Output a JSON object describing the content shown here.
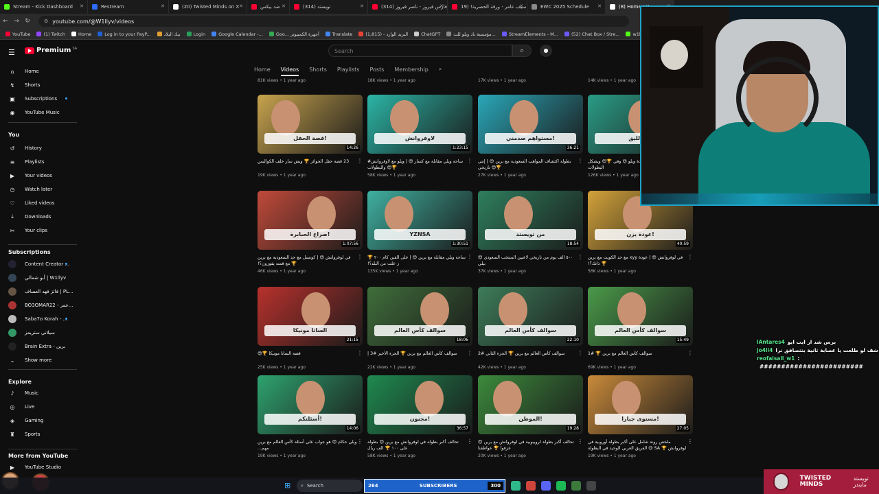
{
  "browser": {
    "tabs": [
      {
        "title": "Stream - Kick Dashboard",
        "color": "#53fc18"
      },
      {
        "title": "Restream",
        "color": "#2d6bfb"
      },
      {
        "title": "(20) Twisted Minds on X",
        "color": "#ffffff"
      },
      {
        "title": "ضد بيكس",
        "color": "#ff0033"
      },
      {
        "title": "(314) تويستد",
        "color": "#ff0033"
      },
      {
        "title": "(314) فارس فيروز - ناصر فيروز",
        "color": "#ff0033"
      },
      {
        "title": "سيف عامر - ورقة الحصرية! (19",
        "color": "#ff0033"
      },
      {
        "title": "EWC 2025 Schedule",
        "color": "#8a8a8a"
      },
      {
        "title": "(8) Home / X",
        "color": "#ffffff"
      }
    ],
    "url": "youtube.com/@W1llyv/videos",
    "bookmarks": [
      {
        "label": "YouTube",
        "color": "#ff0033"
      },
      {
        "label": "(1) Twitch",
        "color": "#9146ff"
      },
      {
        "label": "Home",
        "color": "#ffffff"
      },
      {
        "label": "Log in to your PayP...",
        "color": "#1f62d6"
      },
      {
        "label": "بنك البلاد",
        "color": "#e0a030"
      },
      {
        "label": "Login",
        "color": "#2b9f5a"
      },
      {
        "label": "Google Calendar -...",
        "color": "#4285f4"
      },
      {
        "label": "Goo... أجهزة الكمبيوتر",
        "color": "#34a853"
      },
      {
        "label": "Translate",
        "color": "#4285f4"
      },
      {
        "label": "البريد الوارد - (1,815)",
        "color": "#ea4335"
      },
      {
        "label": "ChatGPT",
        "color": "#cccccc"
      },
      {
        "label": "مؤسسة باد ويلو للت...",
        "color": "#888888"
      },
      {
        "label": "StreamElements - M...",
        "color": "#6b5bff"
      },
      {
        "label": "(52) Chat Box / Stre...",
        "color": "#6b5bff"
      },
      {
        "label": "w1llyv - Kick Stats...",
        "color": "#53fc18"
      }
    ]
  },
  "header": {
    "logo": "Premium",
    "country": "SA",
    "search_placeholder": "Search"
  },
  "sidebar": {
    "main": [
      {
        "label": "Home",
        "icon": "⌂"
      },
      {
        "label": "Shorts",
        "icon": "↯"
      },
      {
        "label": "Subscriptions",
        "icon": "▣"
      },
      {
        "label": "YouTube Music",
        "icon": "◉"
      }
    ],
    "you_title": "You",
    "you": [
      {
        "label": "History",
        "icon": "↺"
      },
      {
        "label": "Playlists",
        "icon": "≡"
      },
      {
        "label": "Your videos",
        "icon": "▶"
      },
      {
        "label": "Watch later",
        "icon": "◷"
      },
      {
        "label": "Liked videos",
        "icon": "♡"
      },
      {
        "label": "Downloads",
        "icon": "⤓"
      },
      {
        "label": "Your clips",
        "icon": "✂"
      }
    ],
    "subs_title": "Subscriptions",
    "subscriptions": [
      {
        "label": "Content Creator ...",
        "color": "#222233"
      },
      {
        "label": "أبو شمالي | W1llyv",
        "color": "#334455"
      },
      {
        "label": "فائز فهد العساف | PL...",
        "color": "#665544"
      },
      {
        "label": "BO3OMAR22 - عمر...",
        "color": "#aa3333"
      },
      {
        "label": "Saba7o Korah - ...",
        "color": "#bbbbbb"
      },
      {
        "label": "سيلاني ستريمز",
        "color": "#339966"
      },
      {
        "label": "Brain Extra - برين",
        "color": "#222222"
      }
    ],
    "show_more": "Show more",
    "explore_title": "Explore",
    "explore": [
      {
        "label": "Music",
        "icon": "♪"
      },
      {
        "label": "Live",
        "icon": "◎"
      },
      {
        "label": "Gaming",
        "icon": "◈"
      },
      {
        "label": "Sports",
        "icon": "♜"
      }
    ],
    "more_title": "More from YouTube",
    "more": [
      {
        "label": "YouTube Studio",
        "icon": "▶"
      }
    ]
  },
  "channel_tabs": [
    "Home",
    "Videos",
    "Shorts",
    "Playlists",
    "Posts",
    "Membership"
  ],
  "active_tab": "Videos",
  "top_meta": [
    "81K views • 1 year ago",
    "18K views • 1 year ago",
    "17K views • 1 year ago",
    "14K views • 1 year ago"
  ],
  "videos": [
    {
      "title": "23 قصة حفل الجوائز 🏆 ويش سار خلف الكواليس",
      "meta": "19K views • 1 year ago",
      "duration": "14:26",
      "caption": "قصة الحفل!",
      "bg": "#c7a34d"
    },
    {
      "title": "ساحة ويلي مقابلة مع كسار 😍 | ويلو مع لاوفروانش# 🏆😍 والبطولات",
      "meta": "58K views • 1 year ago",
      "duration": "1:23:15",
      "caption": "لاوفروانش",
      "bg": "#2bb5a6"
    },
    {
      "title": "بطولة اكتشاف المواهب السعودية مع برين 😍 | إنتي 🏆😍 تاريخي",
      "meta": "27K views • 1 year ago",
      "duration": "36:21",
      "caption": "مستواهم صدمني!",
      "bg": "#2aa7b8"
    },
    {
      "title": "كشف كل الحقائق 😍 | عادة ويلو 😍 وفي 🏆😍 ويشكل البطولات",
      "meta": "126K views • 1 year ago",
      "duration": "",
      "caption": "من الليق",
      "bg": "#2a9c86"
    },
    {
      "title": "في لوفروانش 😍 | كونسل مع حد السعودية مع برين 🏆 مع قمته يفوزون؟!",
      "meta": "46K views • 1 year ago",
      "duration": "1:07:56",
      "caption": "صراع الجبابرة!",
      "bg": "#c04a3a"
    },
    {
      "title": "ساحة ويلي مقابلة مع برين 😍 | على الفين كام ٢٠٠ 🏆 ز علت من البلد؟!",
      "meta": "135K views • 1 year ago",
      "duration": "1:30:51",
      "caption": "YZNSA",
      "bg": "#3fb0a0"
    },
    {
      "title": "٥٠٠ الف يوم من تاريخي لاعبين المنتخب السعودي 😍 بيلي",
      "meta": "37K views • 1 year ago",
      "duration": "18:54",
      "caption": "من تويستد",
      "bg": "#2e7f5e"
    },
    {
      "title": "في لوفروانش 😍 | عودة xyy مع حد الكويت مع برين 🏆 ذاتك؟!",
      "meta": "56K views • 1 year ago",
      "duration": "40:59",
      "caption": "عودة يزن!",
      "bg": "#d3a23a"
    },
    {
      "title": "قصة الساتا مونيكا 🏆😍",
      "meta": "25K views • 1 year ago",
      "duration": "21:15",
      "caption": "الساتا مونيكا",
      "bg": "#b8312c"
    },
    {
      "title": "سوالف كأس العالم مع برين 🏆 الجزء الأخير #3 |",
      "meta": "22K views • 1 year ago",
      "duration": "18:06",
      "caption": "سوالف كأس العالم",
      "bg": "#3f6e3a"
    },
    {
      "title": "سوالف كأس العالم مع برين 🏆 الجزء الثاني #2",
      "meta": "42K views • 1 year ago",
      "duration": "22:10",
      "caption": "سوالف كأس العالم",
      "bg": "#3d7d5a"
    },
    {
      "title": "سوالف كأس العالم مع برين 🏆 #1",
      "meta": "69K views • 1 year ago",
      "duration": "15:49",
      "caption": "سوالف كأس العالم",
      "bg": "#4a9a4a"
    },
    {
      "title": "ويلي حكام 😍 هو جواب على أسئلة كأس العالم مع برين مهم...",
      "meta": "19K views • 1 year ago",
      "duration": "14:06",
      "caption": "أسئلتكم!",
      "bg": "#2ea36f"
    },
    {
      "title": "تحالف أكبر بطولة في لوفروانش مع برين 😍 بطولة على ١٠٠ 🏆 الف ريال",
      "meta": "58K views • 1 year ago",
      "duration": "36:57",
      "caption": "مجنون!",
      "bg": "#1f8a50"
    },
    {
      "title": "تحالف أكبر بطولة لرويبوبية في لوفروانش مع برين 😍 غزفوا 🏆 عواطفنا",
      "meta": "20K views • 1 year ago",
      "duration": "19:28",
      "caption": "الموطن!",
      "bg": "#3c8a3c"
    },
    {
      "title": "ملخص رونة شامل على أكبر بطولة أوروبية في لوفروانش 🏆 SA 😍 الفريق العربي الوحيد في البطولة",
      "meta": "19K views • 1 year ago",
      "duration": "27:05",
      "caption": "مستوى جبارا!",
      "bg": "#c98a3a"
    }
  ],
  "chat": [
    {
      "user": "lAntares4",
      "text": "برس شد ار ايت ايو"
    },
    {
      "user": "jo4li4",
      "text": "شف لو طلعت يا عصابة ثانية بتتصافق نرا :"
    },
    {
      "user": "reofaisall_w1",
      "text": ":"
    },
    {
      "user": "",
      "text": "########################"
    }
  ],
  "taskbar": {
    "search": "Search",
    "subs_current": "264",
    "subs_label": "SUBSCRIBERS",
    "subs_goal": "300",
    "brand_name": "TWISTED MINDS",
    "brand_arabic": "تويستد مايندز"
  }
}
